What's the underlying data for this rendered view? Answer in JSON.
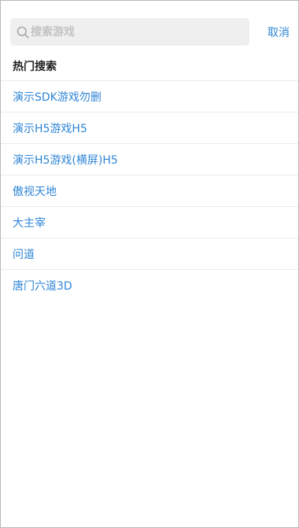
{
  "search": {
    "placeholder": "搜索游戏",
    "value": "",
    "cancel_label": "取消"
  },
  "hot": {
    "title": "热门搜索",
    "items": [
      {
        "label": "演示SDK游戏勿删"
      },
      {
        "label": "演示H5游戏H5"
      },
      {
        "label": "演示H5游戏(横屏)H5"
      },
      {
        "label": "傲视天地"
      },
      {
        "label": "大主宰"
      },
      {
        "label": "问道"
      },
      {
        "label": "唐门六道3D"
      }
    ]
  },
  "icons": {
    "search": "search-icon"
  },
  "colors": {
    "accent": "#2f86d6",
    "input_bg": "#efefef",
    "divider": "#ececec"
  }
}
